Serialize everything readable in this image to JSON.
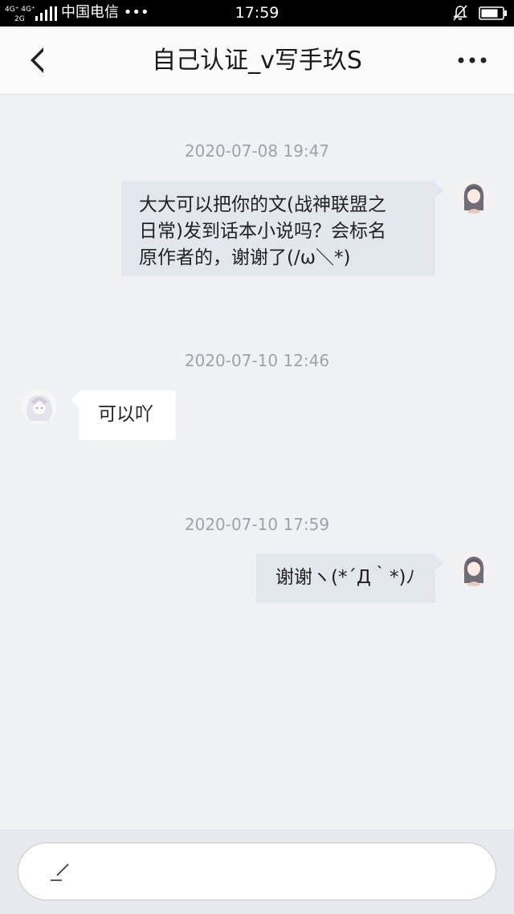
{
  "status_bar": {
    "network_top": "4G⁺ 4G⁺",
    "network_bottom": "2G",
    "carrier": "中国电信 •••",
    "time": "17:59",
    "bell_icon": "bell-muted-icon",
    "battery_icon": "battery-icon"
  },
  "nav": {
    "back_icon": "back-arrow-icon",
    "title": "自己认证_v写手玖S",
    "more_icon": "more-dots-icon"
  },
  "messages": [
    {
      "timestamp": "2020-07-08 19:47",
      "sender": "me",
      "lines": [
        "大大可以把你的文(战神联盟之",
        "日常)发到话本小说吗？会标名",
        "原作者的，谢谢了(/ω＼*)"
      ]
    },
    {
      "timestamp": "2020-07-10 12:46",
      "sender": "other",
      "text": "可以吖"
    },
    {
      "timestamp": "2020-07-10 17:59",
      "sender": "me",
      "text": "谢谢ヽ(*´Д｀*)ﾉ"
    }
  ],
  "input": {
    "pen_icon": "pen-icon",
    "placeholder": ""
  },
  "colors": {
    "background": "#f0f1f5",
    "my_bubble": "#e2e7ee",
    "their_bubble": "#ffffff",
    "timestamp": "#a0a2a8"
  }
}
